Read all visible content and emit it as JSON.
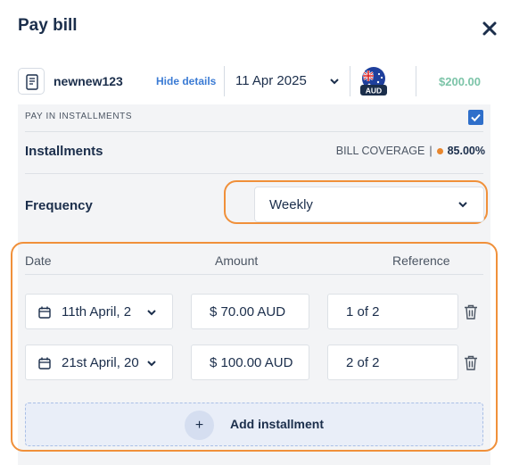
{
  "header": {
    "title": "Pay bill",
    "close_icon": "close-icon"
  },
  "bill": {
    "name": "newnew123",
    "hide_details": "Hide details",
    "date": "11 Apr 2025",
    "currency": "AUD",
    "amount": "$200.00"
  },
  "installments": {
    "pay_in_installments_label": "PAY IN INSTALLMENTS",
    "pay_in_installments_checked": true,
    "title": "Installments",
    "coverage_label": "BILL COVERAGE",
    "coverage_separator": "|",
    "coverage_value": "85.00%",
    "frequency_label": "Frequency",
    "frequency_value": "Weekly",
    "columns": {
      "date": "Date",
      "amount": "Amount",
      "reference": "Reference"
    },
    "rows": [
      {
        "date": "11th April, 2",
        "amount": "$ 70.00 AUD",
        "reference": "1 of 2"
      },
      {
        "date": "21st April, 20",
        "amount": "$ 100.00 AUD",
        "reference": "2 of 2"
      }
    ],
    "add_label": "Add installment",
    "add_icon": "+"
  },
  "colors": {
    "accent": "#3b7bd4",
    "highlight_ring": "#f0903a",
    "amount_green": "#7cc4a8",
    "coverage_dot": "#e8862d"
  }
}
